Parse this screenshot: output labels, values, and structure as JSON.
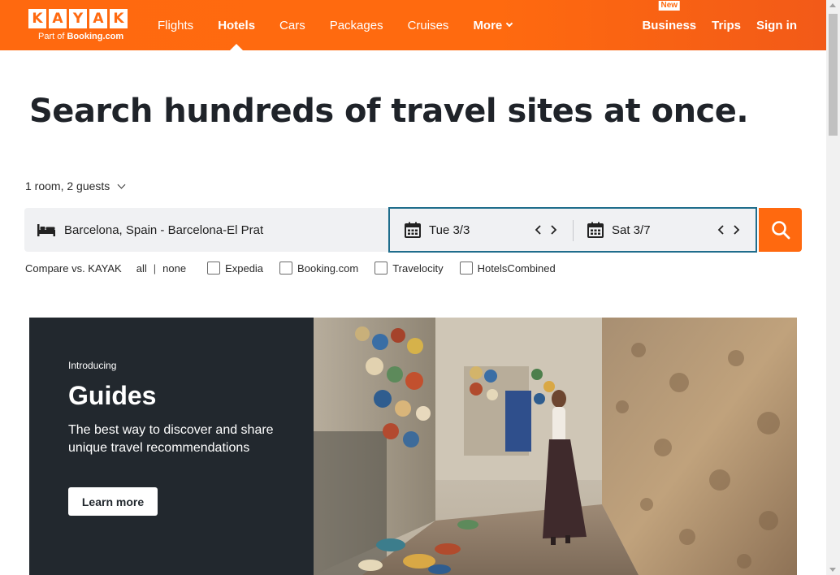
{
  "header": {
    "logo_letters": [
      "K",
      "A",
      "Y",
      "A",
      "K"
    ],
    "logo_sub_prefix": "Part of ",
    "logo_sub_brand": "Booking.com",
    "nav": [
      {
        "label": "Flights"
      },
      {
        "label": "Hotels",
        "active": true
      },
      {
        "label": "Cars"
      },
      {
        "label": "Packages"
      },
      {
        "label": "Cruises"
      },
      {
        "label": "More"
      }
    ],
    "business_label": "Business",
    "new_badge": "New",
    "trips_label": "Trips",
    "signin_label": "Sign in"
  },
  "hero": {
    "headline": "Search hundreds of travel sites at once."
  },
  "search": {
    "guests": "1 room, 2 guests",
    "destination": "Barcelona, Spain - Barcelona-El Prat",
    "checkin": "Tue 3/3",
    "checkout": "Sat 3/7"
  },
  "compare": {
    "label": "Compare vs. KAYAK",
    "all": "all",
    "separator": "|",
    "none": "none",
    "sites": [
      "Expedia",
      "Booking.com",
      "Travelocity",
      "HotelsCombined"
    ]
  },
  "banner": {
    "intro": "Introducing",
    "title": "Guides",
    "description": "The best way to discover and share unique travel recommendations",
    "cta": "Learn more"
  },
  "colors": {
    "brand": "#ff690f",
    "dark_panel": "#22282e",
    "date_border": "#1f6d8c"
  }
}
